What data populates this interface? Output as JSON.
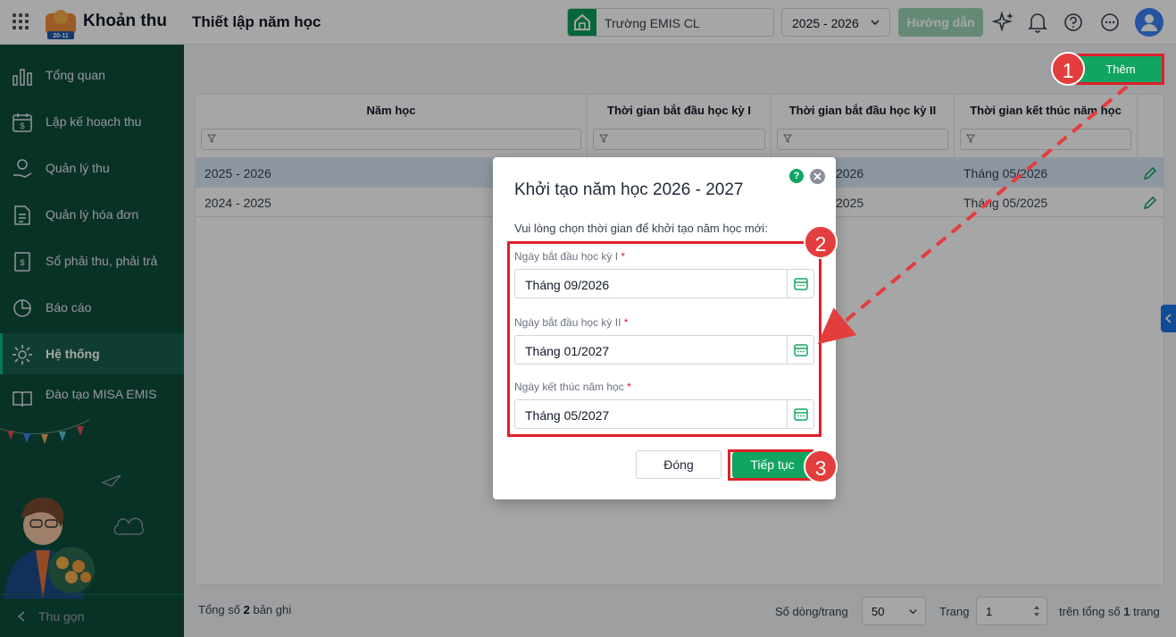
{
  "header": {
    "app_title": "Khoản thu",
    "page_title": "Thiết lập năm học",
    "school": "Trường EMIS CL",
    "school_year": "2025 - 2026",
    "guide_label": "Hướng dẫn",
    "logo_text": "20-11"
  },
  "sidebar": {
    "items": [
      {
        "label": "Tổng quan"
      },
      {
        "label": "Lập kế hoạch thu"
      },
      {
        "label": "Quản lý thu"
      },
      {
        "label": "Quản lý hóa đơn"
      },
      {
        "label": "Sổ phải thu, phải trả"
      },
      {
        "label": "Báo cáo"
      },
      {
        "label": "Hệ thống"
      },
      {
        "label": "Đào tạo MISA EMIS"
      }
    ],
    "collapse_label": "Thu gọn"
  },
  "toolbar": {
    "add_label": "Thêm"
  },
  "table": {
    "columns": [
      "Năm học",
      "Thời gian bắt đầu học kỳ I",
      "Thời gian bắt đầu học kỳ II",
      "Thời gian kết thúc năm học"
    ],
    "rows": [
      [
        "2025 - 2026",
        "",
        "2026",
        "Tháng 05/2026"
      ],
      [
        "2024 - 2025",
        "",
        "2025",
        "Tháng 05/2025"
      ]
    ]
  },
  "footer": {
    "total_prefix": "Tổng số",
    "total_count": "2",
    "total_suffix": "bản ghi",
    "rows_per_page_label": "Số dòng/trang",
    "rows_per_page": "50",
    "page_label": "Trang",
    "page": "1",
    "of_total_prefix": "trên tổng số",
    "of_total_pages": "1",
    "of_total_suffix": "trang"
  },
  "dialog": {
    "title": "Khởi tạo năm học 2026 - 2027",
    "description": "Vui lòng chọn thời gian để khởi tạo năm học mới:",
    "fields": [
      {
        "label": "Ngày bắt đầu học kỳ I",
        "value": "Tháng 09/2026"
      },
      {
        "label": "Ngày bắt đầu học kỳ II",
        "value": "Tháng 01/2027"
      },
      {
        "label": "Ngày kết thúc năm học",
        "value": "Tháng 05/2027"
      }
    ],
    "required_mark": "*",
    "close_label": "Đóng",
    "continue_label": "Tiếp tục",
    "help_symbol": "?"
  },
  "annotations": {
    "badge1": "1",
    "badge2": "2",
    "badge3": "3"
  },
  "colors": {
    "brand_green": "#12a562",
    "sidebar_bg": "#0f4e3c",
    "highlight_red": "#e0202a",
    "selected_row": "#dbe8f7"
  },
  "icons": [
    "grid-icon",
    "school-icon",
    "chevron-down-icon",
    "sparkle-icon",
    "bell-icon",
    "help-icon",
    "more-icon",
    "avatar-icon",
    "filter-icon",
    "pencil-icon",
    "calendar-icon",
    "close-icon"
  ]
}
